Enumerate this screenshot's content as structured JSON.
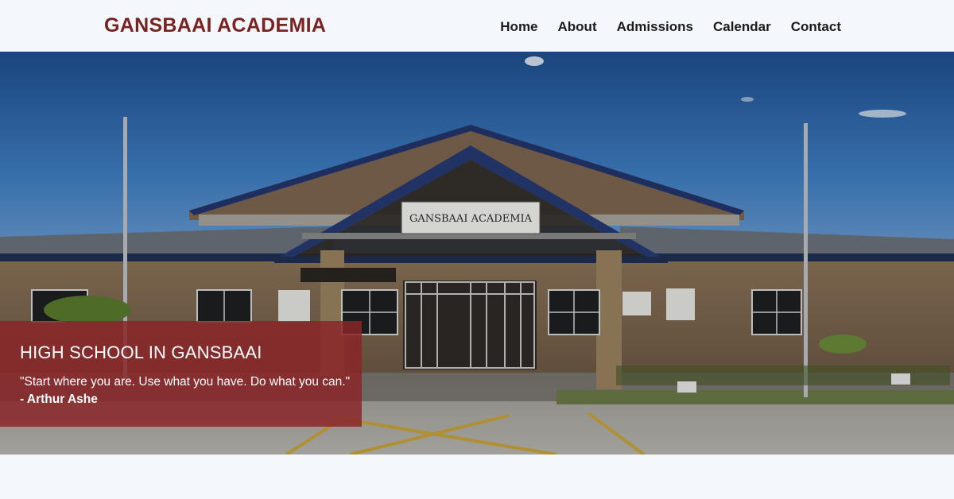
{
  "header": {
    "brand": "GANSBAAI ACADEMIA",
    "nav": [
      "Home",
      "About",
      "Admissions",
      "Calendar",
      "Contact"
    ]
  },
  "hero": {
    "sign_text": "GANSBAAI ACADEMIA",
    "title": "HIGH SCHOOL IN GANSBAAI",
    "quote": "\"Start where you are. Use what you have. Do what you can.\"",
    "author": "- Arthur Ashe"
  },
  "colors": {
    "brand": "#7a2321",
    "overlay": "#8a2628",
    "page_bg": "#f4f8fc",
    "nav_text": "#1b1b1b"
  }
}
